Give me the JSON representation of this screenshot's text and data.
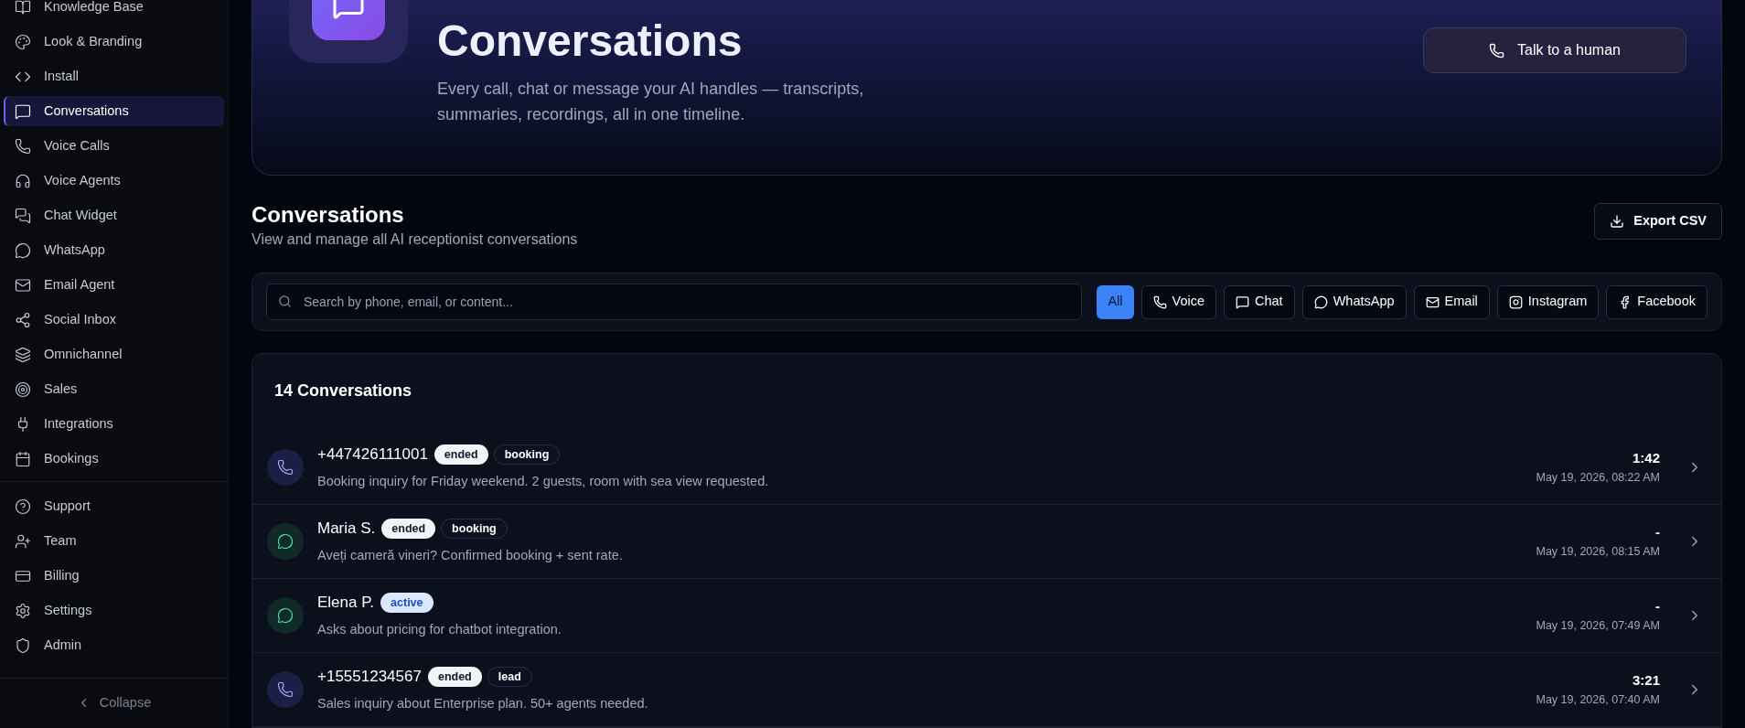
{
  "sidebar": {
    "items": [
      {
        "label": "Knowledge Base",
        "selected": false
      },
      {
        "label": "Look & Branding",
        "selected": false
      },
      {
        "label": "Install",
        "selected": false
      },
      {
        "label": "Conversations",
        "selected": true
      },
      {
        "label": "Voice Calls",
        "selected": false
      },
      {
        "label": "Voice Agents",
        "selected": false
      },
      {
        "label": "Chat Widget",
        "selected": false
      },
      {
        "label": "WhatsApp",
        "selected": false
      },
      {
        "label": "Email Agent",
        "selected": false
      },
      {
        "label": "Social Inbox",
        "selected": false
      },
      {
        "label": "Omnichannel",
        "selected": false
      },
      {
        "label": "Sales",
        "selected": false
      },
      {
        "label": "Integrations",
        "selected": false
      },
      {
        "label": "Bookings",
        "selected": false
      }
    ],
    "footer_items": [
      {
        "label": "Support",
        "selected": false
      },
      {
        "label": "Team",
        "selected": false
      },
      {
        "label": "Billing",
        "selected": false
      },
      {
        "label": "Settings",
        "selected": false
      },
      {
        "label": "Admin",
        "selected": false
      }
    ],
    "collapse": "Collapse"
  },
  "hero": {
    "title": "Conversations",
    "subtitle": "Every call, chat or message your AI handles — transcripts, summaries, recordings, all in one timeline.",
    "button": "Talk to a human"
  },
  "section": {
    "title": "Conversations",
    "subtitle": "View and manage all AI receptionist conversations",
    "export_button": "Export CSV"
  },
  "filters": {
    "search_placeholder": "Search by phone, email, or content...",
    "chips": [
      {
        "label": "All",
        "selected": true
      },
      {
        "label": "Voice",
        "selected": false
      },
      {
        "label": "Chat",
        "selected": false
      },
      {
        "label": "WhatsApp",
        "selected": false
      },
      {
        "label": "Email",
        "selected": false
      },
      {
        "label": "Instagram",
        "selected": false
      },
      {
        "label": "Facebook",
        "selected": false
      }
    ]
  },
  "list": {
    "title": "14 Conversations",
    "rows": [
      {
        "kind": "voice",
        "name": "+447426111001",
        "badges": [
          {
            "label": "ended",
            "kind": "solid"
          },
          {
            "label": "booking",
            "kind": "outline"
          }
        ],
        "summary": "Booking inquiry for Friday weekend. 2 guests, room with sea view requested.",
        "duration": "1:42",
        "time": "May 19, 2026, 08:22 AM"
      },
      {
        "kind": "chat",
        "name": "Maria S.",
        "badges": [
          {
            "label": "ended",
            "kind": "solid"
          },
          {
            "label": "booking",
            "kind": "outline"
          }
        ],
        "summary": "Aveți cameră vineri? Confirmed booking + sent rate.",
        "duration": "-",
        "time": "May 19, 2026, 08:15 AM"
      },
      {
        "kind": "chat",
        "name": "Elena P.",
        "badges": [
          {
            "label": "active",
            "kind": "info"
          }
        ],
        "summary": "Asks about pricing for chatbot integration.",
        "duration": "-",
        "time": "May 19, 2026, 07:49 AM"
      },
      {
        "kind": "voice",
        "name": "+15551234567",
        "badges": [
          {
            "label": "ended",
            "kind": "solid"
          },
          {
            "label": "lead",
            "kind": "outline"
          }
        ],
        "summary": "Sales inquiry about Enterprise plan. 50+ agents needed.",
        "duration": "3:21",
        "time": "May 19, 2026, 07:40 AM"
      }
    ]
  }
}
